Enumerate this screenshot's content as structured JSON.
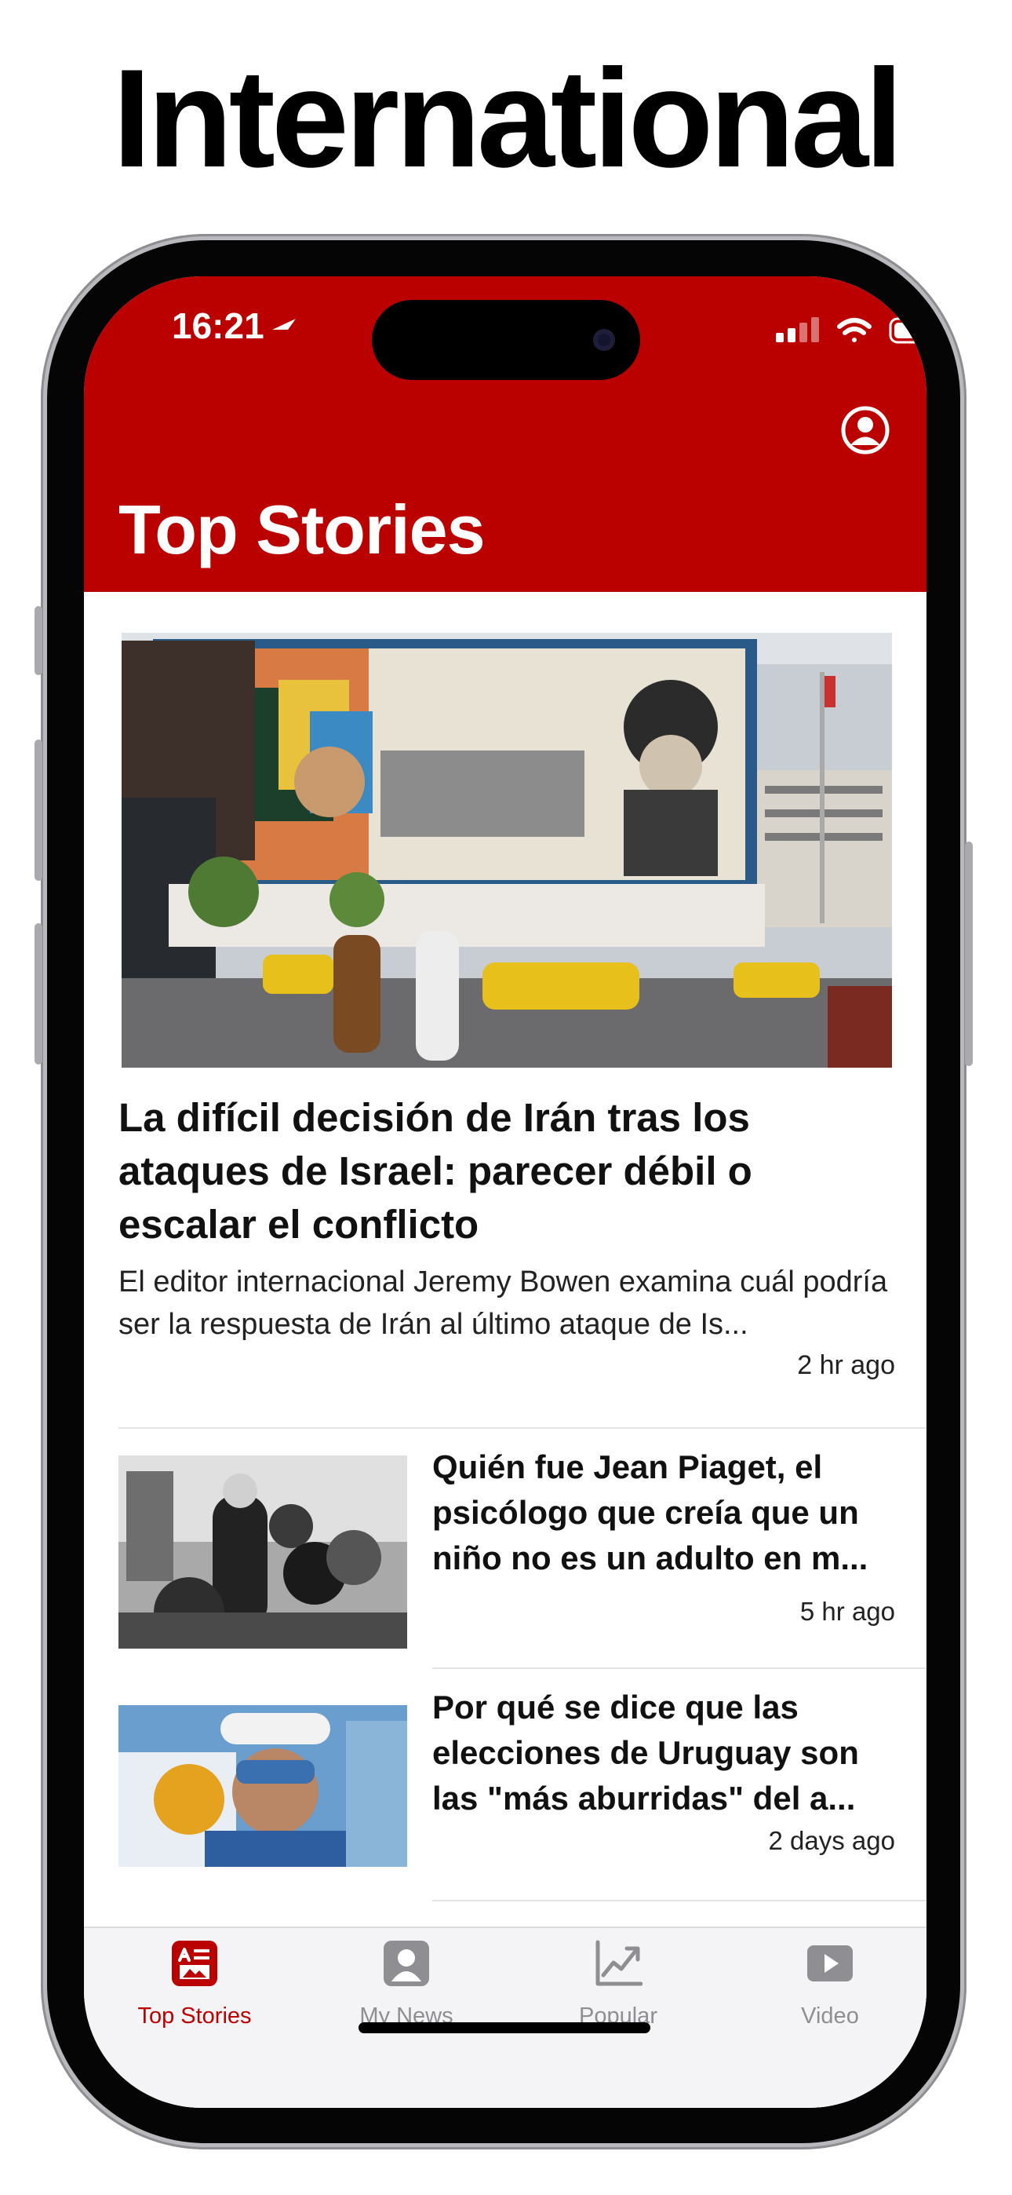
{
  "banner": {
    "title": "International"
  },
  "status_bar": {
    "time": "16:21"
  },
  "header": {
    "title": "Top Stories"
  },
  "hero_story": {
    "title": "La difícil decisión de Irán tras los ataques de Israel: parecer débil o escalar el conflicto",
    "summary": "El editor internacional Jeremy Bowen examina cuál podría ser la respuesta de Irán al último ataque de Is...",
    "time": "2 hr ago"
  },
  "stories": [
    {
      "title": "Quién fue Jean Piaget, el psicólogo que creía que un niño no es un adulto en m...",
      "time": "5 hr ago"
    },
    {
      "title": "Por qué se dice que las elecciones de Uruguay son las \"más aburridas\" del a...",
      "time": "2 days ago"
    }
  ],
  "tab_bar": {
    "tabs": [
      {
        "label": "Top Stories",
        "icon": "top-stories-icon",
        "active": true
      },
      {
        "label": "My News",
        "icon": "my-news-icon",
        "active": false
      },
      {
        "label": "Popular",
        "icon": "popular-chart-icon",
        "active": false
      },
      {
        "label": "Video",
        "icon": "video-play-icon",
        "active": false
      }
    ]
  },
  "colors": {
    "brand_red": "#bb0000",
    "inactive_tab": "#8e8e93",
    "tab_bar_bg": "#f4f4f6"
  }
}
